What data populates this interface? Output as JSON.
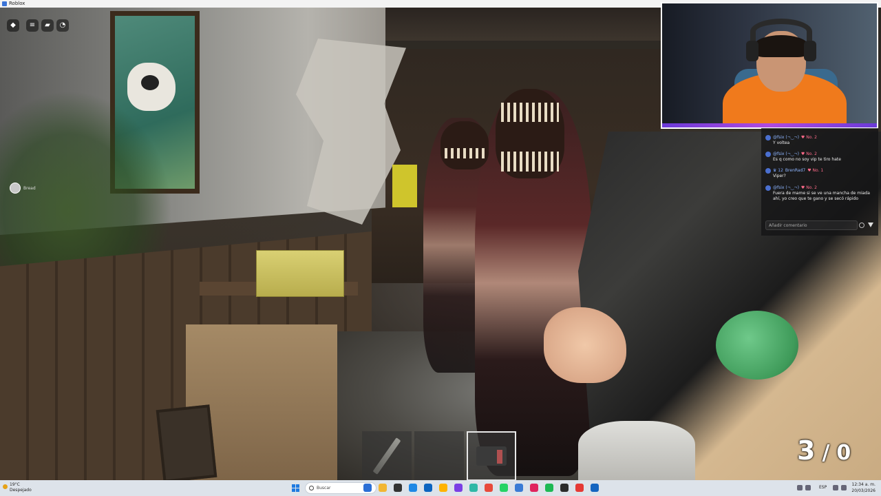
{
  "window": {
    "title": "Roblox"
  },
  "game": {
    "top_buttons": [
      {
        "name": "roblox-menu-button",
        "glyph": "◆"
      },
      {
        "name": "hamburger-menu-button",
        "glyph": "≡"
      },
      {
        "name": "chat-toggle-button",
        "glyph": "▰"
      },
      {
        "name": "voice-chat-button",
        "glyph": "◔"
      }
    ],
    "player_label": "Bread",
    "hotbar": [
      {
        "item": "knife-icon",
        "selected": false
      },
      {
        "item": "",
        "selected": false
      },
      {
        "item": "gun-icon",
        "selected": true
      }
    ],
    "counter": {
      "left": "3",
      "sep": "/",
      "right": "0"
    }
  },
  "chat": {
    "messages": [
      {
        "user": "@fsix (¬‿¬)",
        "badge": "♥ No. 2",
        "text": "Y voltea"
      },
      {
        "user": "@fsix (¬‿¬)",
        "badge": "♥ No. 2",
        "text": "Es q como no soy vip te tiro hate"
      },
      {
        "user": "BrenRad7",
        "sub": "♛ 12",
        "badge": "♥ No. 1",
        "text": "Viper?"
      },
      {
        "user": "@fsix (¬‿¬)",
        "badge": "♥ No. 2",
        "text": "Fuera de mame si se ve una mancha de miada ahí, yo creo que te gano y se secó rápido"
      }
    ],
    "input_placeholder": "Añadir comentario"
  },
  "taskbar": {
    "weather_temp": "19°C",
    "weather_desc": "Despejado",
    "search_label": "Buscar",
    "lang": "ESP",
    "time": "12:34 a. m.",
    "date": "20/03/2026",
    "app_colors": [
      "#2b6fd6",
      "#f2b632",
      "#333333",
      "#1e88e5",
      "#0c64c0",
      "#ffb300",
      "#7b3fe4",
      "#2eb8a6",
      "#e84a3c",
      "#25d366",
      "#3a7bd5",
      "#e0245e",
      "#1db954",
      "#2b2b2b",
      "#e53935",
      "#1565c0"
    ]
  },
  "colors": {
    "cam_border": "#ffffff",
    "cam_accent": "#b04ae0",
    "chat_user": "#8fb6ff",
    "chat_badge": "#ff6b8a"
  }
}
